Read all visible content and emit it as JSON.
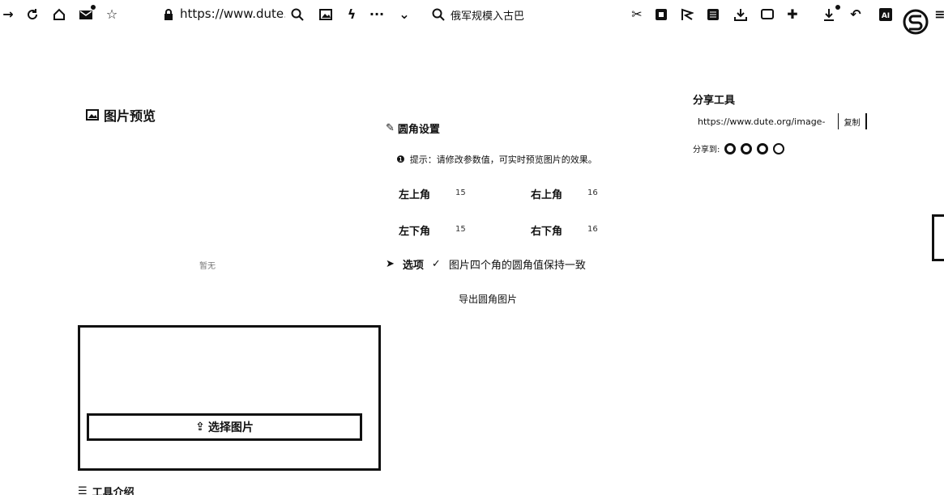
{
  "browser": {
    "url": "https://www.dute.c",
    "search_text": "俄军规模入古巴",
    "icons": [
      "forward-icon",
      "refresh-icon",
      "home-icon",
      "mail-icon",
      "favorites-icon",
      "lock-icon",
      "zoom-icon",
      "image-icon",
      "lightning-icon",
      "more-icon",
      "chevron-down-icon",
      "search-icon",
      "scissors-icon",
      "translate-icon",
      "flag-icon",
      "reader-icon",
      "download-tray-icon",
      "screen-icon",
      "extension-icon",
      "download-icon",
      "undo-icon",
      "ai-icon",
      "profile-icon",
      "menu-icon"
    ]
  },
  "preview": {
    "title": "图片预览",
    "empty_text": "暂无"
  },
  "upload": {
    "choose_label": "选择图片"
  },
  "intro": {
    "title": "工具介绍"
  },
  "radius": {
    "title": "圆角设置",
    "tip": "提示：请修改参数值，可实时预览图片的效果。",
    "corners": [
      {
        "label": "左上角",
        "value": "15"
      },
      {
        "label": "右上角",
        "value": "16"
      },
      {
        "label": "左下角",
        "value": "15"
      },
      {
        "label": "右下角",
        "value": "16"
      }
    ]
  },
  "options": {
    "label": "选项",
    "checkbox_label": "图片四个角的圆角值保持一致",
    "checked": true
  },
  "download": {
    "label": "导出圆角图片"
  },
  "share": {
    "title": "分享工具",
    "url": "https://www.dute.org/image-",
    "copy_label": "复制",
    "share_to_label": "分享到:"
  }
}
